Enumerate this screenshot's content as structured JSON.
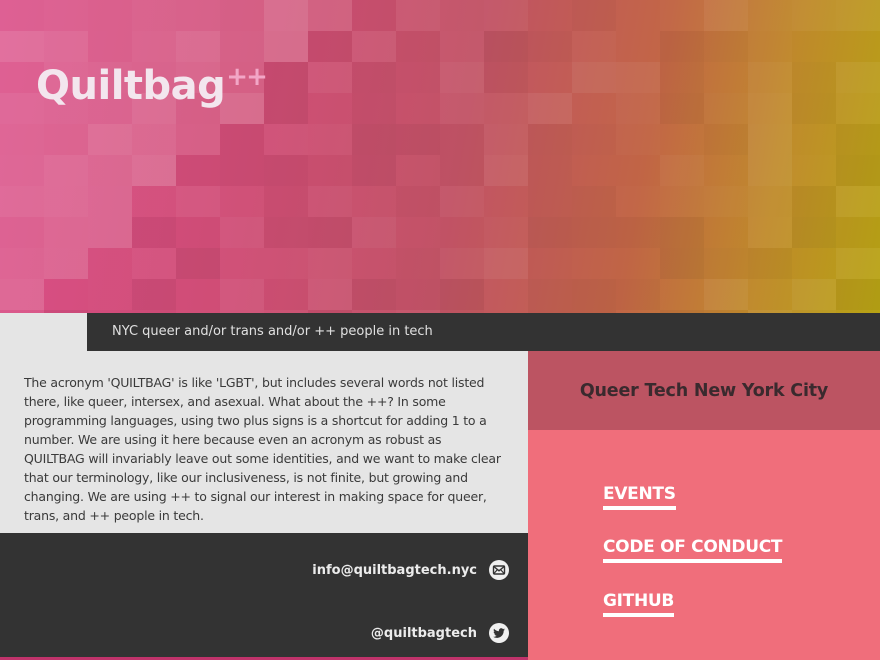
{
  "site": {
    "logo_text": "Quiltbag",
    "logo_suffix": "++",
    "tagline": "NYC queer and/or trans and/or ++ people in tech"
  },
  "about": {
    "text": "The acronym 'QUILTBAG' is like 'LGBT', but includes several words not listed there, like queer, intersex, and asexual. What about the ++? In some programming languages, using two plus signs is a shortcut for adding 1 to a number. We are using it here because even an acronym as robust as QUILTBAG will invariably leave out some identities, and we want to make clear that our terminology, like our inclusiveness, is not finite, but growing and changing. We are using ++ to signal our interest in making space for queer, trans, and ++ people in tech."
  },
  "contact": {
    "email": "info@quiltbagtech.nyc",
    "email_icon": "envelope-icon",
    "twitter": "@quiltbagtech",
    "twitter_icon": "twitter-bird-icon"
  },
  "org": {
    "name": "Queer Tech New York City"
  },
  "nav": {
    "items": [
      {
        "label": "EVENTS"
      },
      {
        "label": "CODE OF CONDUCT"
      },
      {
        "label": "GITHUB"
      }
    ]
  },
  "colors": {
    "hero_pink": "#db4e88",
    "hero_gold": "#b8a414",
    "dark_bar": "#333333",
    "org_box": "#bc5462",
    "nav_bg": "#f06e7b",
    "page_bg": "#e5e5e5"
  }
}
